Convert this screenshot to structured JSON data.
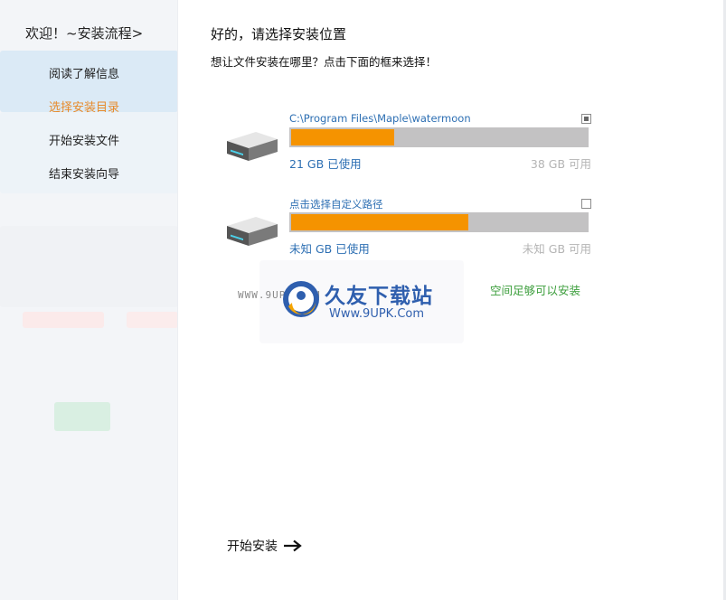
{
  "sidebar": {
    "title": "欢迎！~安装流程>",
    "items": [
      {
        "label": "阅读了解信息",
        "active": false
      },
      {
        "label": "选择安装目录",
        "active": true
      },
      {
        "label": "开始安装文件",
        "active": false
      },
      {
        "label": "结束安装向导",
        "active": false
      }
    ]
  },
  "main": {
    "heading": "好的，请选择安装位置",
    "subheading": "想让文件安装在哪里？点击下面的框来选择！",
    "drives": [
      {
        "path": "C:\\Program Files\\Maple\\watermoon",
        "used": "21 GB 已使用",
        "free": "38 GB 可用",
        "usage_fraction": 0.35,
        "checked": true,
        "icon": "hard-drive-icon"
      },
      {
        "path": "点击选择自定义路径",
        "used": "未知 GB 已使用",
        "free": "未知 GB 可用",
        "usage_fraction": 0.6,
        "checked": false,
        "icon": "hard-drive-icon"
      }
    ],
    "space_status": "空间足够可以安装",
    "start_button": "开始安装"
  },
  "watermark": {
    "www": "WWW.9UPK.COM",
    "name": "久友下载站",
    "url": "Www.9UPK.Com"
  },
  "colors": {
    "accent_active": "#e78a2a",
    "link_blue": "#2d6fb3",
    "bar_fill": "#f59300",
    "bar_track": "#c3c2c3",
    "ok_green": "#3a9d3a"
  }
}
